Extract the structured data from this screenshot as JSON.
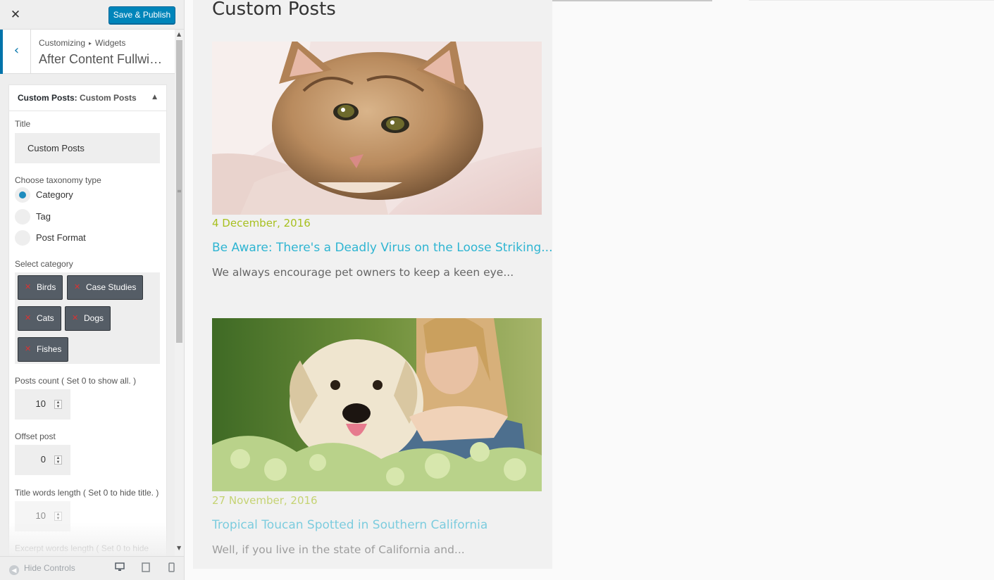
{
  "topbar": {
    "close_icon": "close-icon",
    "save_label": "Save & Publish"
  },
  "section": {
    "back_icon": "chevron-left-icon",
    "breadcrumb_root": "Customizing",
    "breadcrumb_separator": "▸",
    "breadcrumb_current": "Widgets",
    "title": "After Content Fullwidt..."
  },
  "widget": {
    "head_prefix": "Custom Posts:",
    "head_title": "Custom Posts",
    "toggle_icon": "triangle-up-icon",
    "title_label": "Title",
    "title_value": "Custom Posts",
    "taxonomy_label": "Choose taxonomy type",
    "taxonomy_options": [
      {
        "label": "Category",
        "checked": true
      },
      {
        "label": "Tag",
        "checked": false
      },
      {
        "label": "Post Format",
        "checked": false
      }
    ],
    "category_label": "Select category",
    "categories": [
      "Birds",
      "Case Studies",
      "Cats",
      "Dogs",
      "Fishes"
    ],
    "posts_count_label": "Posts count ( Set 0 to show all. )",
    "posts_count_value": "10",
    "offset_label": "Offset post",
    "offset_value": "0",
    "title_words_label": "Title words length ( Set 0 to hide title. )",
    "title_words_value": "10",
    "excerpt_words_label": "Excerpt words length ( Set 0 to hide"
  },
  "footer": {
    "hide_controls_label": "Hide Controls",
    "devices": [
      "desktop-icon",
      "tablet-icon",
      "mobile-icon"
    ]
  },
  "preview": {
    "heading": "Custom Posts",
    "posts": [
      {
        "image": "cat-photo",
        "date": "4 December, 2016",
        "title": "Be Aware: There's a Deadly Virus on the Loose Striking...",
        "excerpt": "We always encourage pet owners to keep a keen eye..."
      },
      {
        "image": "dog-and-woman-photo",
        "date": "27 November, 2016",
        "title": "Tropical Toucan Spotted in Southern California",
        "excerpt": "Well, if you live in the state of California and..."
      }
    ]
  },
  "colors": {
    "primary_button": "#0085ba",
    "accent_blue": "#0073aa",
    "post_date": "#a8c020",
    "post_title": "#2fb5d2",
    "tag_bg": "#555d66",
    "tag_remove": "#dc3232"
  }
}
